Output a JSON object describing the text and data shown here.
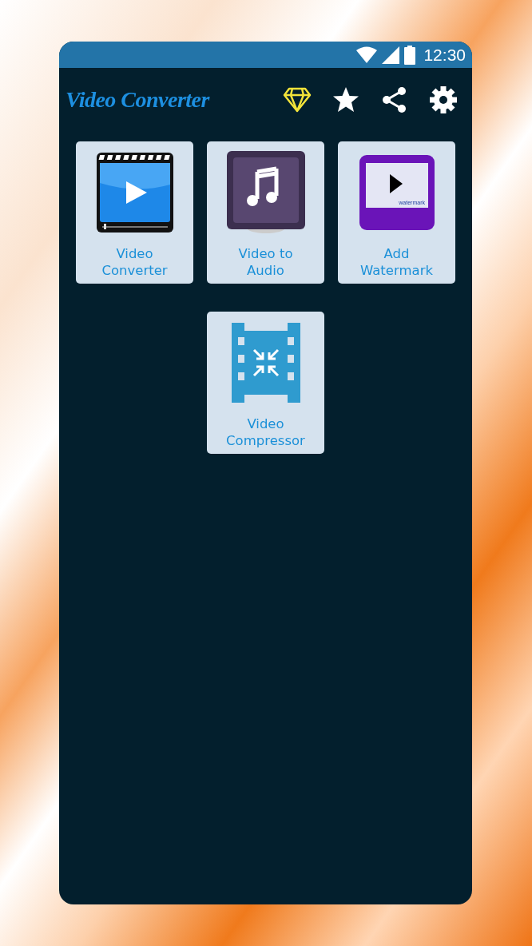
{
  "status_bar": {
    "time": "12:30"
  },
  "app_bar": {
    "title": "Video Converter",
    "actions": [
      {
        "kind": "diamond"
      },
      {
        "kind": "star"
      },
      {
        "kind": "share"
      },
      {
        "kind": "settings"
      }
    ]
  },
  "tools": [
    {
      "kind": "film-play",
      "label": "Video Converter"
    },
    {
      "kind": "music",
      "label": "Video to Audio"
    },
    {
      "kind": "watermark",
      "label": "Add Watermark",
      "icon_text": "watermark"
    },
    {
      "kind": "compress",
      "label": "Video Compressor"
    }
  ]
}
